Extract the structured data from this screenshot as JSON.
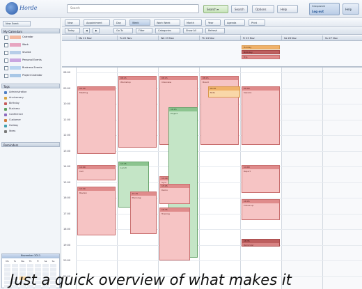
{
  "header": {
    "logo_text": "Horde",
    "search_placeholder": "Search",
    "buttons": [
      "Search ▾",
      "Search",
      "Options",
      "Help"
    ],
    "account": {
      "line1": "Groupware",
      "line2": "Log out"
    },
    "help_label": "Help"
  },
  "sidebar": {
    "new_event_label": "New Event",
    "calendars_heading": "My Calendars",
    "calendars": [
      {
        "name": "Calendar",
        "color": "#f4b9a0"
      },
      {
        "name": "Work",
        "color": "#e7a5c0"
      },
      {
        "name": "Shared",
        "color": "#b7cde8"
      },
      {
        "name": "Personal Events",
        "color": "#c9a6e0"
      },
      {
        "name": "Business Events",
        "color": "#b9d4f0"
      },
      {
        "name": "Project Calendar",
        "color": "#a8c7e6"
      }
    ],
    "tags_heading": "Tags",
    "tags": [
      {
        "name": "Administration",
        "color": "#4f7fc4"
      },
      {
        "name": "Anniversary",
        "color": "#d9a641"
      },
      {
        "name": "Birthday",
        "color": "#c65b5b"
      },
      {
        "name": "Business",
        "color": "#5f9f5f"
      },
      {
        "name": "Conference",
        "color": "#8d6bbf"
      },
      {
        "name": "Customer",
        "color": "#d07a3c"
      },
      {
        "name": "Holiday",
        "color": "#3f9fb0"
      },
      {
        "name": "Ideas",
        "color": "#7a7a7a"
      }
    ],
    "notes_heading": "Reminders",
    "mini_calendar": {
      "title": "November 2011",
      "weekday_headers": [
        "Mo",
        "Tu",
        "We",
        "Th",
        "Fr",
        "Sa",
        "Su"
      ],
      "highlighted_index": 23
    }
  },
  "toolbar": {
    "row1": [
      "New",
      "Appointment",
      "Day",
      "Week",
      "Work Week",
      "Month",
      "Year",
      "Agenda",
      "Print"
    ],
    "row2": [
      "Today",
      "◀",
      "▶",
      "Go To",
      "Filter",
      "Categories",
      "Show All",
      "Refresh"
    ]
  },
  "days": [
    "Mo 21 Nov",
    "Tu 22 Nov",
    "We 23 Nov",
    "Th 24 Nov",
    "Fr 25 Nov",
    "Sa 26 Nov",
    "Su 27 Nov"
  ],
  "times": [
    "08:00",
    "09:00",
    "10:00",
    "11:00",
    "12:00",
    "13:00",
    "14:00",
    "15:00",
    "16:00",
    "17:00",
    "18:00",
    "19:00",
    "20:00",
    "21:00"
  ],
  "events": [
    {
      "day": 0,
      "start": 0.9,
      "end": 5.2,
      "title": "Meeting",
      "time": "09:00",
      "kind": "red"
    },
    {
      "day": 0,
      "start": 5.9,
      "end": 6.9,
      "title": "Call",
      "time": "14:00",
      "kind": "red"
    },
    {
      "day": 0,
      "start": 7.3,
      "end": 10.4,
      "title": "Review",
      "time": "15:30",
      "kind": "red"
    },
    {
      "day": 1,
      "start": 0.2,
      "end": 4.8,
      "title": "Workshop",
      "time": "08:15",
      "kind": "red"
    },
    {
      "day": 1,
      "start": 5.7,
      "end": 8.6,
      "title": "Lunch",
      "time": "13:45",
      "kind": "green"
    },
    {
      "day": 1,
      "start": 7.6,
      "end": 10.3,
      "title": "Planning",
      "time": "15:45",
      "kind": "red"
    },
    {
      "day": 2,
      "start": 0.2,
      "end": 4.6,
      "title": "Interview",
      "time": "08:15",
      "kind": "red"
    },
    {
      "day": 2,
      "start": 6.6,
      "end": 7.4,
      "title": "Sync",
      "time": "14:40",
      "kind": "red"
    },
    {
      "day": 2,
      "start": 2.2,
      "end": 11.8,
      "title": "Project",
      "time": "10:15",
      "kind": "green"
    },
    {
      "day": 2,
      "start": 7.1,
      "end": 8.4,
      "title": "Demo",
      "time": "15:05",
      "kind": "red"
    },
    {
      "day": 2,
      "start": 8.6,
      "end": 12.0,
      "title": "Training",
      "time": "16:35",
      "kind": "red"
    },
    {
      "day": 3,
      "start": 0.2,
      "end": 4.6,
      "title": "Board",
      "time": "08:15",
      "kind": "red"
    },
    {
      "day": 3,
      "start": 0.9,
      "end": 1.6,
      "title": "Note",
      "time": "09:00",
      "kind": "orange"
    },
    {
      "day": 4,
      "start": 0.9,
      "end": 4.6,
      "title": "Session",
      "time": "09:00",
      "kind": "red"
    },
    {
      "day": 4,
      "start": 5.9,
      "end": 7.7,
      "title": "Report",
      "time": "14:00",
      "kind": "red"
    },
    {
      "day": 4,
      "start": 8.1,
      "end": 9.4,
      "title": "Follow-up",
      "time": "16:05",
      "kind": "red"
    },
    {
      "day": 4,
      "start": 10.6,
      "end": 11.1,
      "title": "Reminder",
      "time": "18:35",
      "kind": "dark"
    }
  ],
  "allday_events": [
    {
      "day": 4,
      "row": 0,
      "title": "Holiday",
      "kind": "orange"
    },
    {
      "day": 4,
      "row": 1,
      "title": "Birthday",
      "kind": "dark"
    },
    {
      "day": 4,
      "row": 2,
      "title": "Trip",
      "kind": "red"
    }
  ],
  "caption": "Just a quick overview of what makes it"
}
